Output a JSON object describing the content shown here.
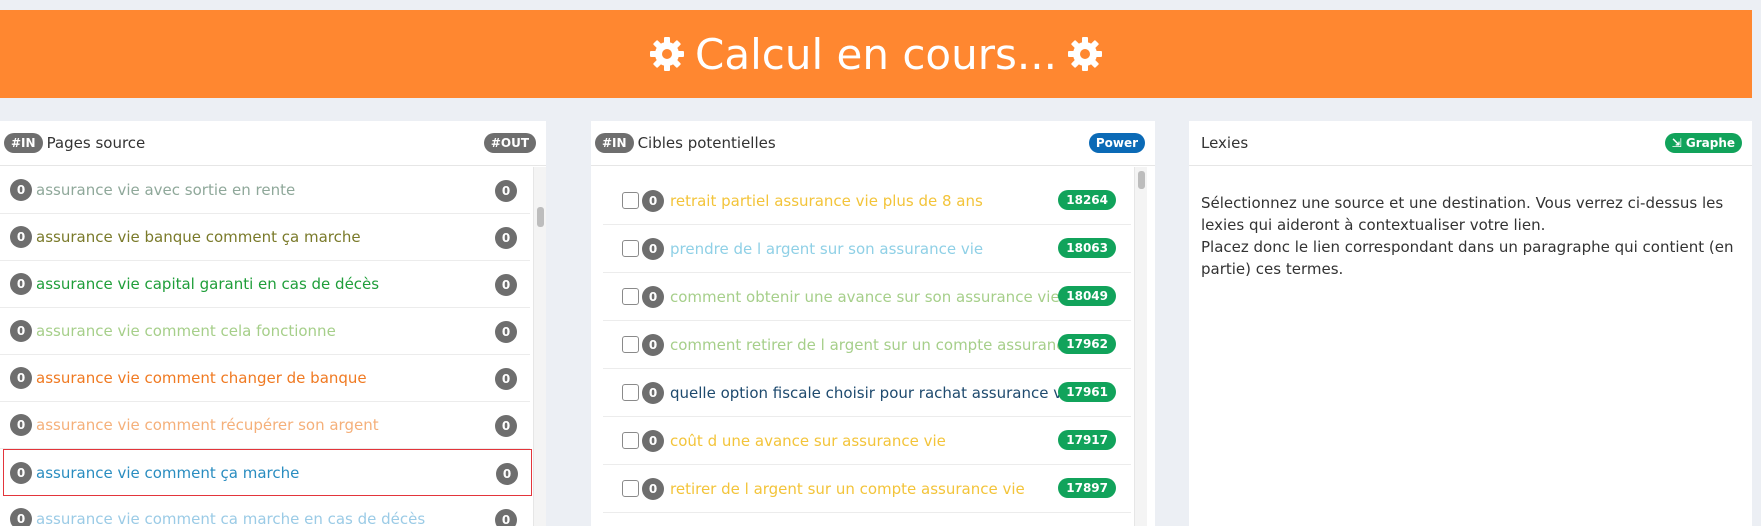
{
  "banner": {
    "text": "Calcul en cours...",
    "color": "#ff8730"
  },
  "panels": {
    "source": {
      "in_badge": "#IN",
      "title": "Pages source",
      "out_badge": "#OUT",
      "items": [
        {
          "text": "assurance vie avec sortie en rente",
          "color": "#8fa89a",
          "left": "0",
          "right": "0",
          "selected": false
        },
        {
          "text": "assurance vie banque comment ça marche",
          "color": "#7a7a2a",
          "left": "0",
          "right": "0",
          "selected": false
        },
        {
          "text": "assurance vie capital garanti en cas de décès",
          "color": "#1f9e3a",
          "left": "0",
          "right": "0",
          "selected": false
        },
        {
          "text": "assurance vie comment cela fonctionne",
          "color": "#a6cf8a",
          "left": "0",
          "right": "0",
          "selected": false
        },
        {
          "text": "assurance vie comment changer de banque",
          "color": "#f07a22",
          "left": "0",
          "right": "0",
          "selected": false
        },
        {
          "text": "assurance vie comment récupérer son argent",
          "color": "#f5b07a",
          "left": "0",
          "right": "0",
          "selected": false
        },
        {
          "text": "assurance vie comment ça marche",
          "color": "#2a8dc0",
          "left": "0",
          "right": "0",
          "selected": true
        },
        {
          "text": "assurance vie comment ca marche en cas de décès",
          "color": "#9bcbe6",
          "left": "0",
          "right": "0",
          "selected": false
        }
      ]
    },
    "targets": {
      "in_badge": "#IN",
      "title": "Cibles potentielles",
      "power_badge": "Power",
      "items": [
        {
          "text": "retrait partiel assurance vie plus de 8 ans",
          "color": "#f3c43a",
          "count": "0",
          "score": "18264"
        },
        {
          "text": "prendre de l argent sur son assurance vie",
          "color": "#8fd0e6",
          "count": "0",
          "score": "18063"
        },
        {
          "text": "comment obtenir une avance sur son assurance vie",
          "color": "#a6cf8a",
          "count": "0",
          "score": "18049"
        },
        {
          "text": "comment retirer de l argent sur un compte assurance vie",
          "color": "#a6cf8a",
          "count": "0",
          "score": "17962"
        },
        {
          "text": "quelle option fiscale choisir pour rachat assurance vie",
          "color": "#1e4a6e",
          "count": "0",
          "score": "17961"
        },
        {
          "text": "coût d une avance sur assurance vie",
          "color": "#f3c43a",
          "count": "0",
          "score": "17917"
        },
        {
          "text": "retirer de l argent sur un compte assurance vie",
          "color": "#f3c43a",
          "count": "0",
          "score": "17897"
        }
      ]
    },
    "lexies": {
      "title": "Lexies",
      "graph_badge": "Graphe",
      "line1": "Sélectionnez une source et une destination. Vous verrez ci-dessus les lexies qui aideront à contextualiser votre lien.",
      "line2": "Placez donc le lien correspondant dans un paragraphe qui contient (en partie) ces termes."
    }
  }
}
